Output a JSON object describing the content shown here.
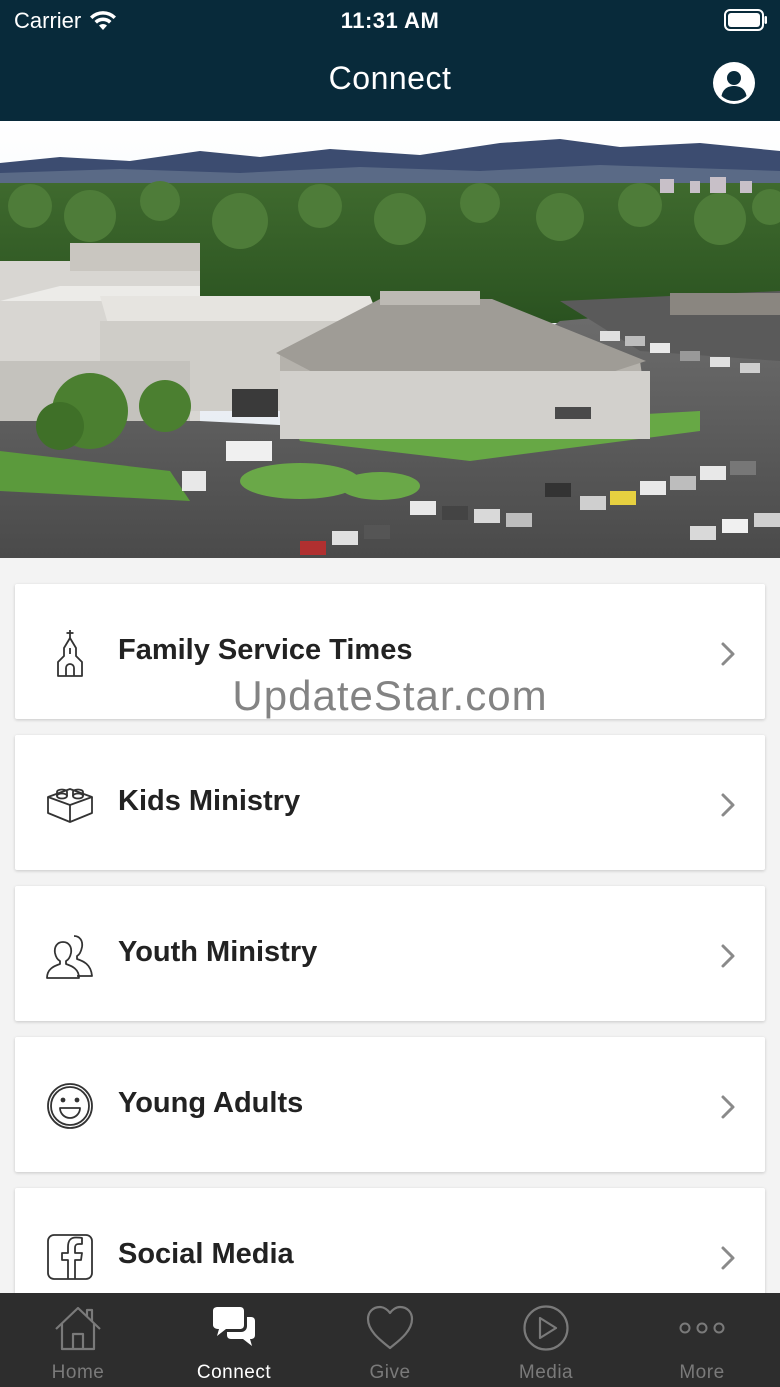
{
  "status_bar": {
    "carrier": "Carrier",
    "time": "11:31 AM"
  },
  "nav": {
    "title": "Connect",
    "profile_icon": "user-circle-icon"
  },
  "hero": {
    "alt": "Aerial view of church campus"
  },
  "menu": [
    {
      "label": "Family Service Times",
      "icon": "church-icon"
    },
    {
      "label": "Kids Ministry",
      "icon": "lego-brick-icon"
    },
    {
      "label": "Youth Ministry",
      "icon": "people-icon"
    },
    {
      "label": "Young Adults",
      "icon": "smiley-icon"
    },
    {
      "label": "Social Media",
      "icon": "facebook-icon"
    }
  ],
  "watermark": "UpdateStar.com",
  "tabs": [
    {
      "label": "Home",
      "icon": "home-icon",
      "active": false
    },
    {
      "label": "Connect",
      "icon": "chat-bubbles-icon",
      "active": true
    },
    {
      "label": "Give",
      "icon": "heart-icon",
      "active": false
    },
    {
      "label": "Media",
      "icon": "play-circle-icon",
      "active": false
    },
    {
      "label": "More",
      "icon": "ellipsis-icon",
      "active": false
    }
  ],
  "colors": {
    "nav_background": "#082a3a",
    "tabbar_background": "#2d2d2d",
    "tab_active": "#ffffff",
    "tab_inactive": "#7a7a7a"
  }
}
